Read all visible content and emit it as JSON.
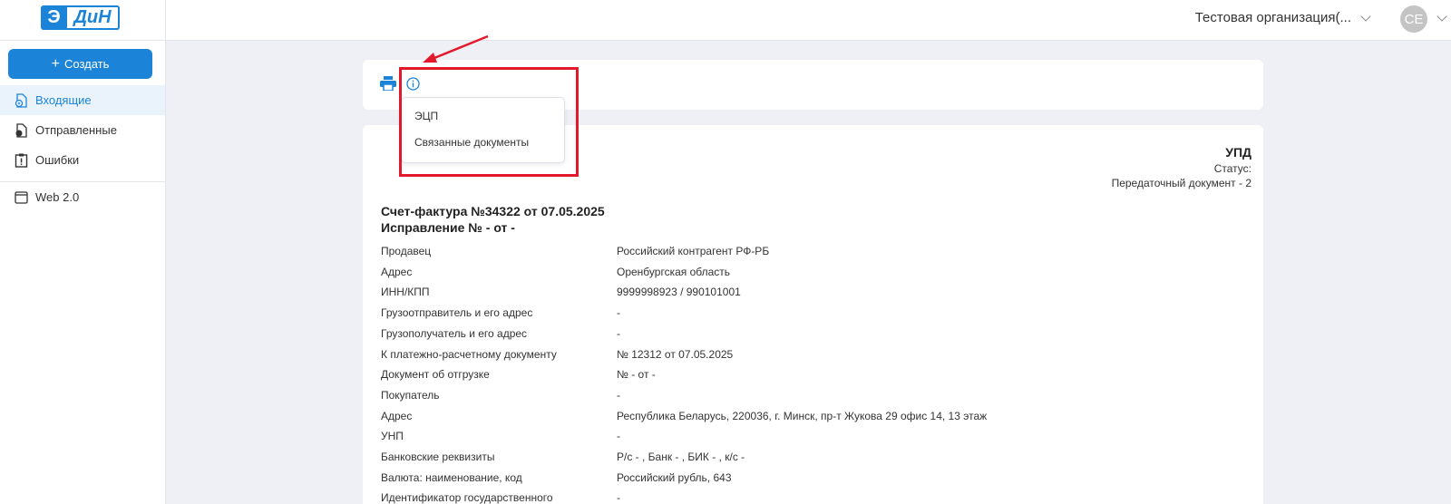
{
  "header": {
    "logo_left": "Э",
    "logo_right": "ДиН",
    "org_name": "Тестовая организация(...",
    "avatar_initials": "CE"
  },
  "sidebar": {
    "create_label": "Создать",
    "items": [
      {
        "label": "Входящие"
      },
      {
        "label": "Отправленные"
      },
      {
        "label": "Ошибки"
      },
      {
        "label": "Web 2.0"
      }
    ]
  },
  "dropdown": {
    "items": [
      {
        "label": "ЭЦП"
      },
      {
        "label": "Связанные документы"
      }
    ]
  },
  "document": {
    "type": "УПД",
    "status_label": "Статус:",
    "function": "Передаточный документ - 2",
    "invoice_title": "Счет-фактура №34322 от 07.05.2025",
    "correction": "Исправление № - от -",
    "rows": [
      {
        "key": "Продавец",
        "value": "Российский контрагент РФ-РБ"
      },
      {
        "key": "Адрес",
        "value": "Оренбургская область"
      },
      {
        "key": "ИНН/КПП",
        "value": "9999998923 / 990101001"
      },
      {
        "key": "Грузоотправитель и его адрес",
        "value": "-"
      },
      {
        "key": "Грузополучатель и его адрес",
        "value": "-"
      },
      {
        "key": "К платежно-расчетному документу",
        "value": "№ 12312 от 07.05.2025"
      },
      {
        "key": "Документ об отгрузке",
        "value": "№ - от -"
      },
      {
        "key": "Покупатель",
        "value": "-"
      },
      {
        "key": "Адрес",
        "value": "Республика Беларусь, 220036, г. Минск, пр-т Жукова 29 офис 14, 13 этаж"
      },
      {
        "key": "УНП",
        "value": "-"
      },
      {
        "key": "Банковские реквизиты",
        "value": "Р/с - , Банк - , БИК - , к/с -"
      },
      {
        "key": "Валюта: наименование, код",
        "value": "Российский рубль, 643"
      },
      {
        "key": "Идентификатор государственного",
        "value": "-"
      }
    ]
  },
  "colors": {
    "accent": "#1b84d8",
    "highlight": "#e3192b"
  }
}
